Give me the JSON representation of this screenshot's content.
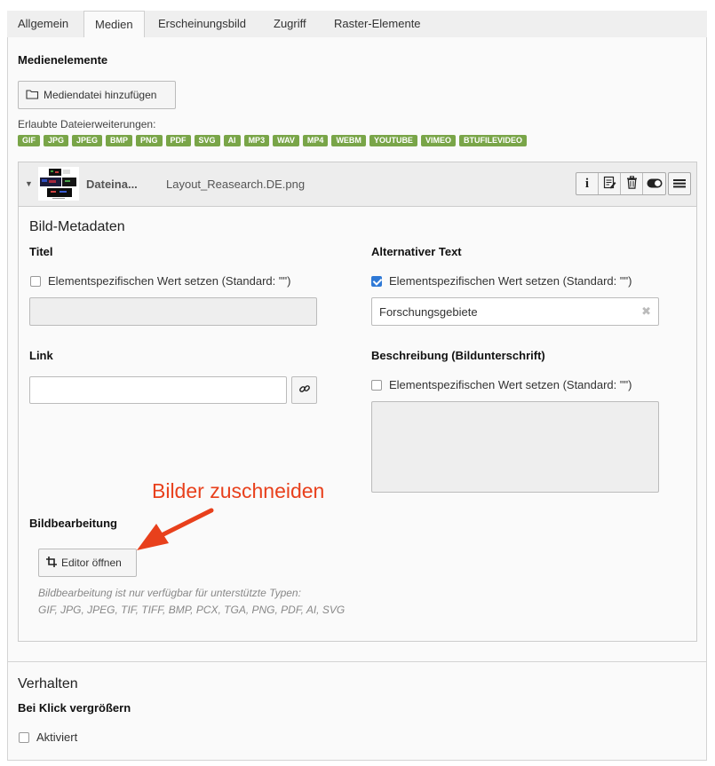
{
  "tabs": [
    "Allgemein",
    "Medien",
    "Erscheinungsbild",
    "Zugriff",
    "Raster-Elemente"
  ],
  "active_tab": "Medien",
  "medien": {
    "section_title": "Medienelemente",
    "add_button_label": "Mediendatei hinzufügen",
    "allowed_label": "Erlaubte Dateierweiterungen:",
    "extensions": [
      "GIF",
      "JPG",
      "JPEG",
      "BMP",
      "PNG",
      "PDF",
      "SVG",
      "AI",
      "MP3",
      "WAV",
      "MP4",
      "WEBM",
      "YOUTUBE",
      "VIMEO",
      "BTUFILEVIDEO"
    ],
    "badge_color": "#79a548"
  },
  "file": {
    "name_label": "Dateina...",
    "name_value": "Layout_Reasearch.DE.png",
    "tools": [
      "info-icon",
      "edit-icon",
      "trash-icon",
      "toggle-icon"
    ],
    "menu_icon": "hamburger-icon"
  },
  "metadata": {
    "title": "Bild-Metadaten",
    "titel_label": "Titel",
    "titel_checkbox": "Elementspezifischen Wert setzen (Standard: \"\")",
    "titel_checked": false,
    "titel_value": "",
    "alt_label": "Alternativer Text",
    "alt_checkbox": "Elementspezifischen Wert setzen (Standard: \"\")",
    "alt_checked": true,
    "alt_value": "Forschungsgebiete",
    "link_label": "Link",
    "link_value": "",
    "desc_label": "Beschreibung (Bildunterschrift)",
    "desc_checkbox": "Elementspezifischen Wert setzen (Standard: \"\")",
    "desc_checked": false,
    "desc_value": ""
  },
  "editing": {
    "label": "Bildbearbeitung",
    "button_label": "Editor öffnen",
    "hint_line1": "Bildbearbeitung ist nur verfügbar für unterstützte Typen:",
    "hint_line2": "GIF, JPG, JPEG, TIF, TIFF, BMP, PCX, TGA, PNG, PDF, AI, SVG"
  },
  "annotation": {
    "text": "Bilder zuschneiden",
    "color": "#e8401c"
  },
  "verhalten": {
    "title": "Verhalten",
    "zoom_label": "Bei Klick vergrößern",
    "zoom_checkbox": "Aktiviert",
    "zoom_checked": false
  }
}
